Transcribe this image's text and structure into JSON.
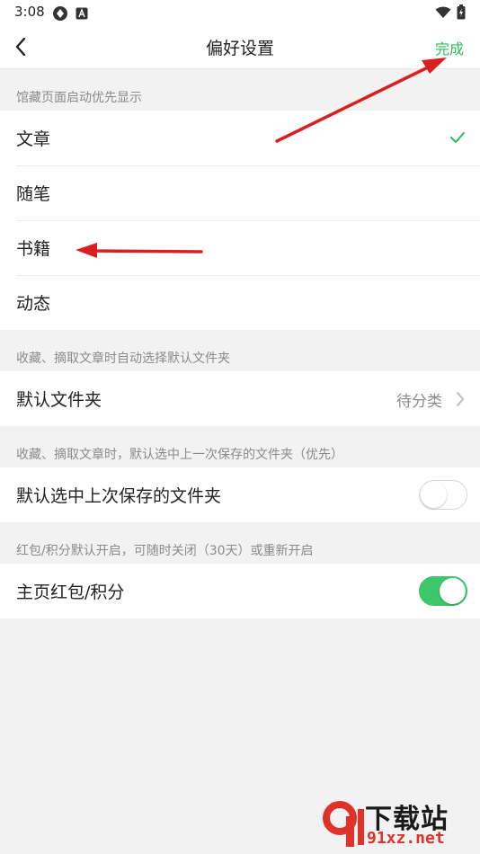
{
  "status_bar": {
    "time": "3:08"
  },
  "nav": {
    "title": "偏好设置",
    "done_label": "完成",
    "accent_color": "#2dbb56"
  },
  "section_startup": {
    "header": "馆藏页面启动优先显示",
    "options": [
      {
        "label": "文章",
        "selected": true
      },
      {
        "label": "随笔",
        "selected": false
      },
      {
        "label": "书籍",
        "selected": false
      },
      {
        "label": "动态",
        "selected": false
      }
    ]
  },
  "section_default_folder": {
    "header": "收藏、摘取文章时自动选择默认文件夹",
    "row_label": "默认文件夹",
    "row_value": "待分类"
  },
  "section_last_folder": {
    "header": "收藏、摘取文章时，默认选中上一次保存的文件夹（优先）",
    "row_label": "默认选中上次保存的文件夹",
    "toggle_on": false
  },
  "section_rewards": {
    "header": "红包/积分默认开启，可随时关闭（30天）或重新开启",
    "row_label": "主页红包/积分",
    "toggle_on": true
  },
  "watermark": {
    "text": "下载站",
    "domain": "91xz.net"
  },
  "colors": {
    "toggle_on": "#3dc66a",
    "annotation_arrow": "#d9201f"
  }
}
